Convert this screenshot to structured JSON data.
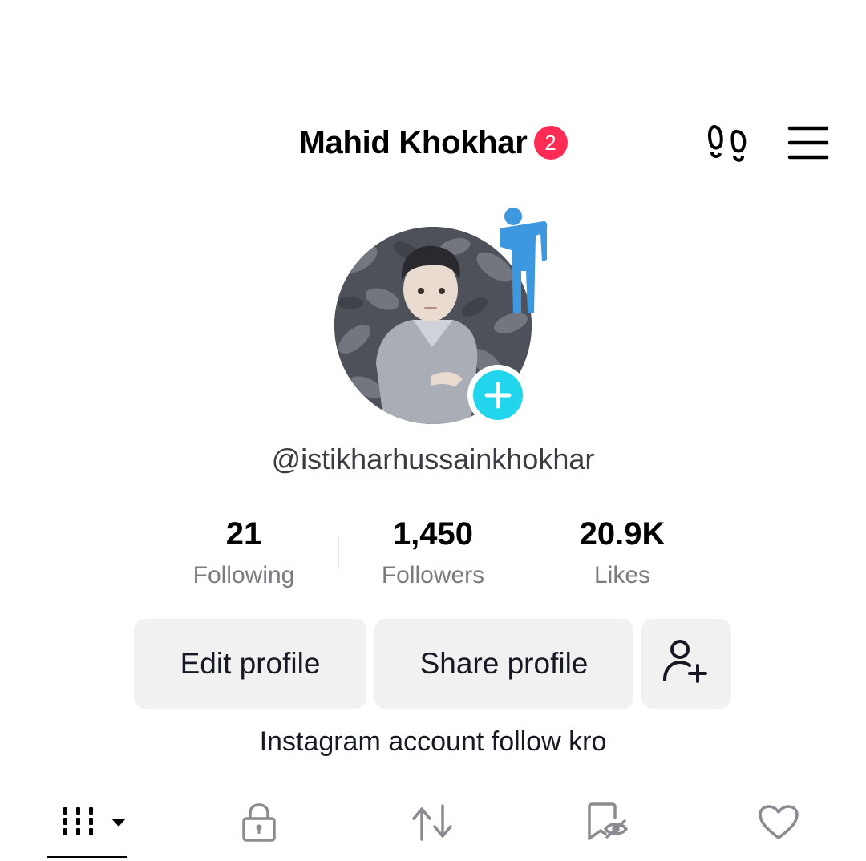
{
  "header": {
    "title": "Mahid Khokhar",
    "badge_count": "2",
    "icons": [
      "footprint-icon",
      "menu-icon"
    ]
  },
  "profile": {
    "username": "@istikharhussainkhokhar",
    "bio": "Instagram account follow kro"
  },
  "stats": [
    {
      "value": "21",
      "label": "Following"
    },
    {
      "value": "1,450",
      "label": "Followers"
    },
    {
      "value": "20.9K",
      "label": "Likes"
    }
  ],
  "actions": {
    "edit_label": "Edit profile",
    "share_label": "Share profile",
    "add_friend_icon": "add-friend-icon"
  },
  "tabs": [
    {
      "icon": "videos-grid-icon",
      "active": true
    },
    {
      "icon": "lock-icon"
    },
    {
      "icon": "repost-icon"
    },
    {
      "icon": "favorites-icon"
    },
    {
      "icon": "liked-icon"
    }
  ],
  "colors": {
    "badge": "#fe2c55",
    "avatar_add": "#20d5ec",
    "figure": "#3d98e0",
    "button_bg": "#f1f1f2"
  }
}
